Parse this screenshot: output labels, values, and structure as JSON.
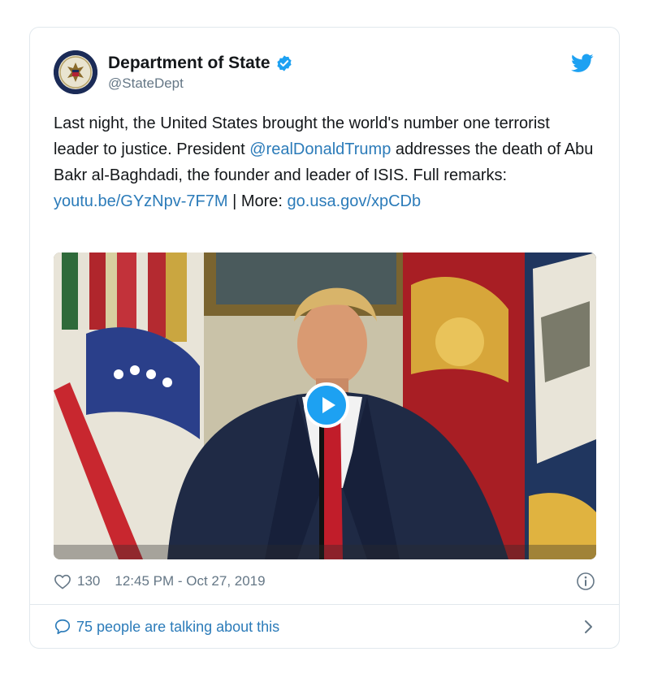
{
  "tweet": {
    "display_name": "Department of State",
    "handle": "@StateDept",
    "verified": true,
    "text_parts": [
      "Last night, the United States brought the world's number one terrorist leader to justice. President ",
      "@realDonaldTrump",
      " addresses the death of Abu Bakr al-Baghdadi, the founder and leader of ISIS. Full remarks: ",
      "youtu.be/GYzNpv-7F7M",
      " | More: ",
      "go.usa.gov/xpCDb"
    ],
    "likes": "130",
    "timestamp": "12:45 PM - Oct 27, 2019",
    "conversation_label": "75 people are talking about this"
  },
  "icons": {
    "avatar": "state-department-seal",
    "verified": "verified-badge-icon",
    "platform": "twitter-bird-icon",
    "play": "play-icon",
    "like": "heart-icon",
    "info": "info-icon",
    "conversation": "comment-bubble-icon",
    "more": "chevron-right-icon"
  },
  "colors": {
    "link": "#2b7bb9",
    "brand_blue": "#1da1f2",
    "muted_text": "#657786",
    "border": "#e1e8ed"
  }
}
